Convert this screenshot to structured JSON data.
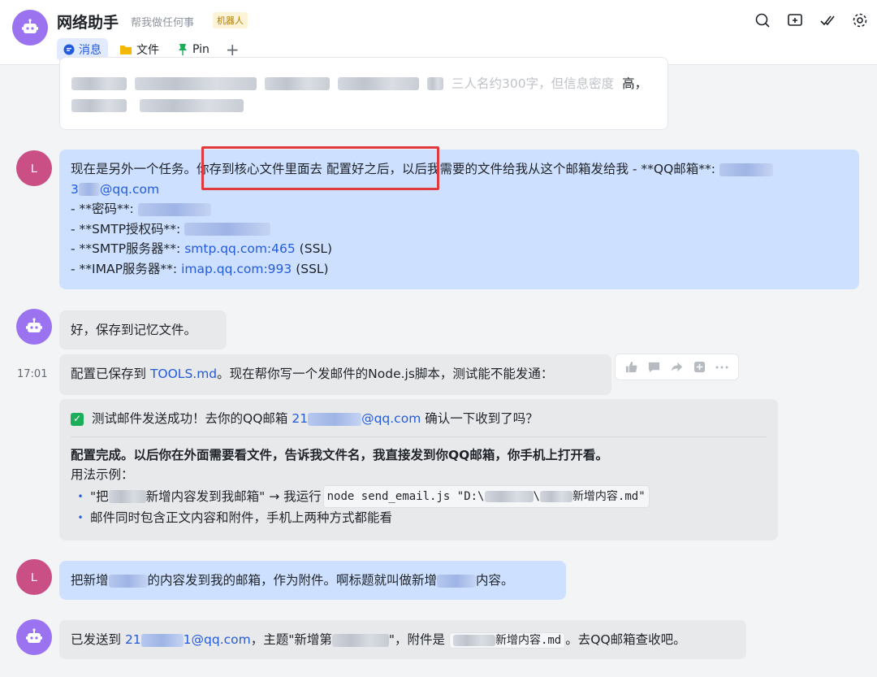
{
  "header": {
    "title": "网络助手",
    "subtitle": "帮我做任何事",
    "tag": "机器人",
    "tabs": [
      {
        "label": "消息",
        "icon": "chat-bubble-icon"
      },
      {
        "label": "文件",
        "icon": "folder-icon"
      },
      {
        "label": "Pin",
        "icon": "pin-icon"
      }
    ],
    "add_tab": "+"
  },
  "messages": {
    "m0": {
      "line1_suffix": "三人名约300字，但信息密度",
      "line1_end": "高，"
    },
    "m1": {
      "intro": "现在是另外一个任务。",
      "highlight": "你存到核心文件里面去 配置好之后，",
      "rest": "以后我需要的文件给我从这个邮箱发给我 - **QQ邮箱**:",
      "email_prefix": "3",
      "email_suffix": "@qq.com",
      "line_pwd": "- **密码**:",
      "line_smtp_code": "- **SMTP授权码**:",
      "line_smtp_server_label": "- **SMTP服务器**: ",
      "smtp_server": "smtp.qq.com:465",
      "smtp_ssl": " (SSL)",
      "line_imap_label": "- **IMAP服务器**: ",
      "imap_server": "imap.qq.com:993",
      "imap_ssl": " (SSL)"
    },
    "m2": {
      "text": "好，保存到记忆文件。"
    },
    "m3": {
      "time": "17:01",
      "prefix": "配置已保存到 ",
      "file": "TOOLS.md",
      "suffix": "。现在帮你写一个发邮件的Node.js脚本，测试能不能发通："
    },
    "m4": {
      "success_prefix": "测试邮件发送成功！去你的QQ邮箱 ",
      "email_prefix": "21",
      "email_suffix": "@qq.com",
      "success_suffix": " 确认一下收到了吗？",
      "bold": "配置完成。以后你在外面需要看文件，告诉我文件名，我直接发到你QQ邮箱，你手机上打开看。",
      "usage": "用法示例：",
      "item1_a": "\"把",
      "item1_b": "新增内容发到我邮箱\" → 我运行 ",
      "item1_code_a": "node send_email.js \"D:\\",
      "item1_code_b": "\\",
      "item1_code_c": "新增内容.md\"",
      "item2": "邮件同时包含正文内容和附件，手机上两种方式都能看"
    },
    "m5": {
      "a": "把新增",
      "b": "的内容发到我的邮箱，作为附件。啊标题就叫做新增",
      "c": "内容。"
    },
    "m6": {
      "a": "已发送到 ",
      "email_prefix": "21",
      "email_suffix": "1@qq.com",
      "b": "，主题\"新增第",
      "c": "\"，附件是 ",
      "code": "新增内容.md",
      "d": "。去QQ邮箱查收吧。"
    }
  },
  "user_avatar_letter": "L",
  "colors": {
    "accent": "#245bdb",
    "bot_avatar": "#9b72f0",
    "user_avatar": "#c94f85",
    "highlight_box": "#e03a3e",
    "user_bubble": "#cde0ff",
    "bot_bubble": "#e8e9eb"
  }
}
